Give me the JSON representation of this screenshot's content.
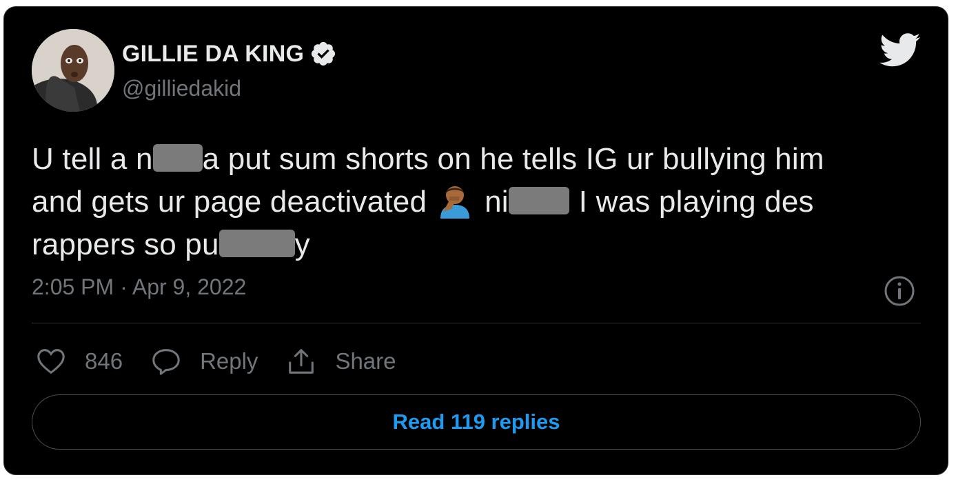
{
  "tweet": {
    "author": {
      "display_name": "GILLIE DA KING",
      "handle": "@gilliedakid",
      "verified": true
    },
    "text_segments": {
      "s1": "U tell a n",
      "s2": "a put sum shorts on he tells IG ur bullying him",
      "s3": "and gets ur page deactivated",
      "s4": "ni",
      "s5": "I was playing des",
      "s6": "rappers so pu",
      "s7": "y"
    },
    "emoji": "facepalm-emoji",
    "timestamp": "2:05 PM · Apr 9, 2022",
    "likes": "846",
    "reply_label": "Reply",
    "share_label": "Share",
    "read_replies_label": "Read 119 replies"
  },
  "colors": {
    "background": "#000000",
    "text": "#e7e9ea",
    "muted": "#71767b",
    "accent": "#1d9bf0",
    "verified_badge": "#e7e9ea"
  },
  "icons": {
    "brand": "twitter-bird-icon",
    "verified": "verified-badge-icon",
    "info": "info-icon",
    "like": "heart-icon",
    "reply": "reply-icon",
    "share": "share-icon"
  }
}
